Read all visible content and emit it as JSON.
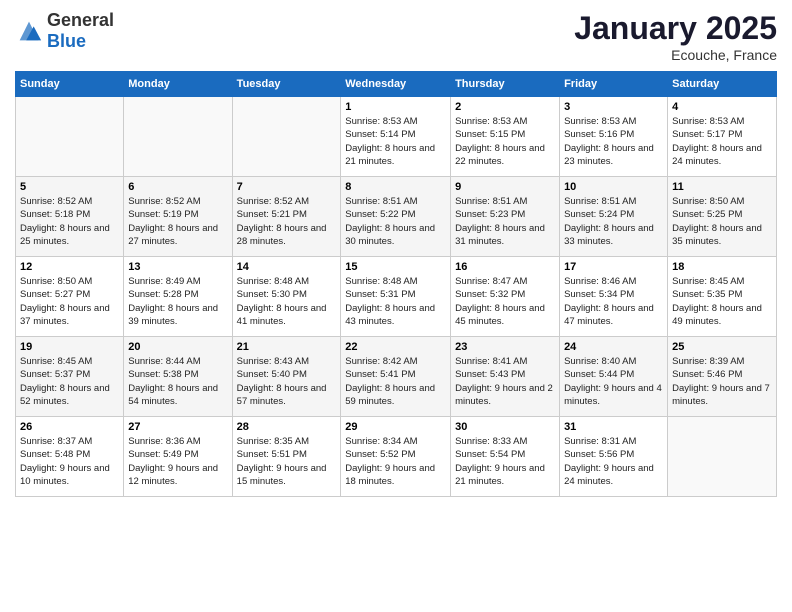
{
  "header": {
    "logo_general": "General",
    "logo_blue": "Blue",
    "month_title": "January 2025",
    "location": "Ecouche, France"
  },
  "weekdays": [
    "Sunday",
    "Monday",
    "Tuesday",
    "Wednesday",
    "Thursday",
    "Friday",
    "Saturday"
  ],
  "weeks": [
    [
      {
        "day": "",
        "info": ""
      },
      {
        "day": "",
        "info": ""
      },
      {
        "day": "",
        "info": ""
      },
      {
        "day": "1",
        "info": "Sunrise: 8:53 AM\nSunset: 5:14 PM\nDaylight: 8 hours and 21 minutes."
      },
      {
        "day": "2",
        "info": "Sunrise: 8:53 AM\nSunset: 5:15 PM\nDaylight: 8 hours and 22 minutes."
      },
      {
        "day": "3",
        "info": "Sunrise: 8:53 AM\nSunset: 5:16 PM\nDaylight: 8 hours and 23 minutes."
      },
      {
        "day": "4",
        "info": "Sunrise: 8:53 AM\nSunset: 5:17 PM\nDaylight: 8 hours and 24 minutes."
      }
    ],
    [
      {
        "day": "5",
        "info": "Sunrise: 8:52 AM\nSunset: 5:18 PM\nDaylight: 8 hours and 25 minutes."
      },
      {
        "day": "6",
        "info": "Sunrise: 8:52 AM\nSunset: 5:19 PM\nDaylight: 8 hours and 27 minutes."
      },
      {
        "day": "7",
        "info": "Sunrise: 8:52 AM\nSunset: 5:21 PM\nDaylight: 8 hours and 28 minutes."
      },
      {
        "day": "8",
        "info": "Sunrise: 8:51 AM\nSunset: 5:22 PM\nDaylight: 8 hours and 30 minutes."
      },
      {
        "day": "9",
        "info": "Sunrise: 8:51 AM\nSunset: 5:23 PM\nDaylight: 8 hours and 31 minutes."
      },
      {
        "day": "10",
        "info": "Sunrise: 8:51 AM\nSunset: 5:24 PM\nDaylight: 8 hours and 33 minutes."
      },
      {
        "day": "11",
        "info": "Sunrise: 8:50 AM\nSunset: 5:25 PM\nDaylight: 8 hours and 35 minutes."
      }
    ],
    [
      {
        "day": "12",
        "info": "Sunrise: 8:50 AM\nSunset: 5:27 PM\nDaylight: 8 hours and 37 minutes."
      },
      {
        "day": "13",
        "info": "Sunrise: 8:49 AM\nSunset: 5:28 PM\nDaylight: 8 hours and 39 minutes."
      },
      {
        "day": "14",
        "info": "Sunrise: 8:48 AM\nSunset: 5:30 PM\nDaylight: 8 hours and 41 minutes."
      },
      {
        "day": "15",
        "info": "Sunrise: 8:48 AM\nSunset: 5:31 PM\nDaylight: 8 hours and 43 minutes."
      },
      {
        "day": "16",
        "info": "Sunrise: 8:47 AM\nSunset: 5:32 PM\nDaylight: 8 hours and 45 minutes."
      },
      {
        "day": "17",
        "info": "Sunrise: 8:46 AM\nSunset: 5:34 PM\nDaylight: 8 hours and 47 minutes."
      },
      {
        "day": "18",
        "info": "Sunrise: 8:45 AM\nSunset: 5:35 PM\nDaylight: 8 hours and 49 minutes."
      }
    ],
    [
      {
        "day": "19",
        "info": "Sunrise: 8:45 AM\nSunset: 5:37 PM\nDaylight: 8 hours and 52 minutes."
      },
      {
        "day": "20",
        "info": "Sunrise: 8:44 AM\nSunset: 5:38 PM\nDaylight: 8 hours and 54 minutes."
      },
      {
        "day": "21",
        "info": "Sunrise: 8:43 AM\nSunset: 5:40 PM\nDaylight: 8 hours and 57 minutes."
      },
      {
        "day": "22",
        "info": "Sunrise: 8:42 AM\nSunset: 5:41 PM\nDaylight: 8 hours and 59 minutes."
      },
      {
        "day": "23",
        "info": "Sunrise: 8:41 AM\nSunset: 5:43 PM\nDaylight: 9 hours and 2 minutes."
      },
      {
        "day": "24",
        "info": "Sunrise: 8:40 AM\nSunset: 5:44 PM\nDaylight: 9 hours and 4 minutes."
      },
      {
        "day": "25",
        "info": "Sunrise: 8:39 AM\nSunset: 5:46 PM\nDaylight: 9 hours and 7 minutes."
      }
    ],
    [
      {
        "day": "26",
        "info": "Sunrise: 8:37 AM\nSunset: 5:48 PM\nDaylight: 9 hours and 10 minutes."
      },
      {
        "day": "27",
        "info": "Sunrise: 8:36 AM\nSunset: 5:49 PM\nDaylight: 9 hours and 12 minutes."
      },
      {
        "day": "28",
        "info": "Sunrise: 8:35 AM\nSunset: 5:51 PM\nDaylight: 9 hours and 15 minutes."
      },
      {
        "day": "29",
        "info": "Sunrise: 8:34 AM\nSunset: 5:52 PM\nDaylight: 9 hours and 18 minutes."
      },
      {
        "day": "30",
        "info": "Sunrise: 8:33 AM\nSunset: 5:54 PM\nDaylight: 9 hours and 21 minutes."
      },
      {
        "day": "31",
        "info": "Sunrise: 8:31 AM\nSunset: 5:56 PM\nDaylight: 9 hours and 24 minutes."
      },
      {
        "day": "",
        "info": ""
      }
    ]
  ]
}
